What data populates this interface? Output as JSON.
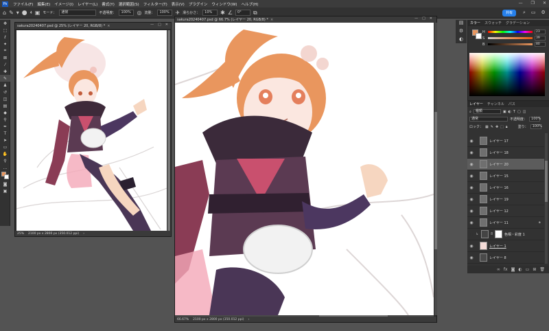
{
  "menubar": {
    "items": [
      "ファイル(F)",
      "編集(E)",
      "イメージ(I)",
      "レイヤー(L)",
      "書式(Y)",
      "選択範囲(S)",
      "フィルター(T)",
      "表示(V)",
      "プラグイン",
      "ウィンドウ(W)",
      "ヘルプ(H)"
    ]
  },
  "options": {
    "mode_label": "モード：",
    "mode_value": "通常",
    "opacity_label": "不透明度：",
    "opacity_value": "100%",
    "flow_label": "流量：",
    "flow_value": "100%",
    "smoothing_label": "滑らかさ：",
    "smoothing_value": "10%",
    "angle_value": "0°",
    "brush_size": "4",
    "share_label": "共有"
  },
  "docs": {
    "small": {
      "title": "sakura20240407.psd @ 25% (レイヤー 20, RGB/8) *",
      "zoom": "25%",
      "info": "2100 px x 2800 px (350.012 ppi)"
    },
    "large": {
      "title": "sakura20240407.psd @ 66.7% (レイヤー 20, RGB/8) *",
      "zoom": "66.67%",
      "info": "2100 px x 2800 px (350.012 ppi)"
    }
  },
  "color_panel": {
    "tabs": [
      "カラー",
      "スウォッチ",
      "グラデーション"
    ],
    "channels": [
      {
        "label": "H",
        "value": "23"
      },
      {
        "label": "S",
        "value": "39"
      },
      {
        "label": "B",
        "value": "80"
      }
    ]
  },
  "layers_panel": {
    "tabs": [
      "レイヤー",
      "チャンネル",
      "パス"
    ],
    "filter_label": "種類",
    "blend_mode": "通常",
    "opacity_label": "不透明度：",
    "opacity_value": "100%",
    "lock_label": "ロック：",
    "fill_label": "塗り：",
    "fill_value": "100%",
    "layers": [
      {
        "name": "レイヤー 17",
        "selected": false
      },
      {
        "name": "レイヤー 18",
        "selected": false
      },
      {
        "name": "レイヤー 20",
        "selected": true
      },
      {
        "name": "レイヤー 15",
        "selected": false
      },
      {
        "name": "レイヤー 16",
        "selected": false
      },
      {
        "name": "レイヤー 19",
        "selected": false
      },
      {
        "name": "レイヤー 12",
        "selected": false
      },
      {
        "name": "レイヤー 11",
        "selected": false
      },
      {
        "name": "色相・彩度 1",
        "selected": false
      },
      {
        "name": "レイヤー 1",
        "selected": false
      },
      {
        "name": "レイヤー 8",
        "selected": false
      }
    ]
  },
  "colors": {
    "accent": "#2680eb",
    "hair": "#e9965e",
    "outfit": "#5b3a52",
    "sash": "#c9506e"
  }
}
